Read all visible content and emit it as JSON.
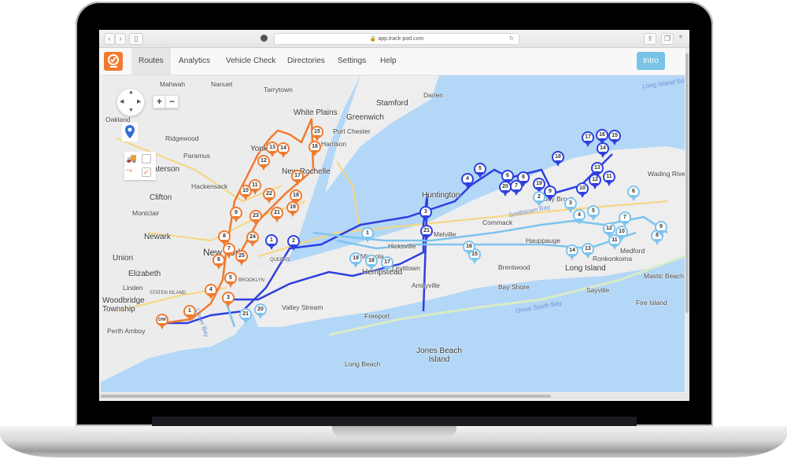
{
  "browser": {
    "url": "app.track-pod.com",
    "back_icon": "chevron-left-icon",
    "forward_icon": "chevron-right-icon",
    "sidebar_icon": "sidebar-icon",
    "privacy_icon": "privacy-icon",
    "reload_icon": "reload-icon",
    "share_icon": "share-icon",
    "tabs_icon": "tabs-icon",
    "new_tab_label": "+"
  },
  "app": {
    "brand_color": "#f07a2e",
    "nav": [
      {
        "label": "Routes",
        "active": true
      },
      {
        "label": "Analytics"
      },
      {
        "label": "Vehicle Check"
      },
      {
        "label": "Directories"
      },
      {
        "label": "Settings"
      },
      {
        "label": "Help"
      }
    ],
    "intro_button": "Intro",
    "intro_color": "#79c3e6"
  },
  "map": {
    "controls": {
      "zoom_in": "+",
      "zoom_out": "−"
    },
    "layer_toggles": [
      {
        "icon": "truck-icon",
        "checked": false
      },
      {
        "icon": "route-icon",
        "checked": true
      }
    ],
    "labels": [
      {
        "text": "Mahwah"
      },
      {
        "text": "Nanuet"
      },
      {
        "text": "Tarrytown"
      },
      {
        "text": "Oakland"
      },
      {
        "text": "Ridgewood"
      },
      {
        "text": "Paramus"
      },
      {
        "text": "Paterson"
      },
      {
        "text": "Hackensack"
      },
      {
        "text": "Clifton"
      },
      {
        "text": "Montclair"
      },
      {
        "text": "Newark"
      },
      {
        "text": "Union"
      },
      {
        "text": "Elizabeth"
      },
      {
        "text": "Linden"
      },
      {
        "text": "Woodbridge Township"
      },
      {
        "text": "Perth Amboy"
      },
      {
        "text": "Staten Island"
      },
      {
        "text": "Lower Bay"
      },
      {
        "text": "New York"
      },
      {
        "text": "Brooklyn"
      },
      {
        "text": "Queens"
      },
      {
        "text": "Yonkers"
      },
      {
        "text": "New Rochelle"
      },
      {
        "text": "White Plains"
      },
      {
        "text": "Harrison"
      },
      {
        "text": "Port Chester"
      },
      {
        "text": "Greenwich"
      },
      {
        "text": "Stamford"
      },
      {
        "text": "Darien"
      },
      {
        "text": "Long Island Sound"
      },
      {
        "text": "Huntington"
      },
      {
        "text": "Hicksville"
      },
      {
        "text": "Melville"
      },
      {
        "text": "Levittown"
      },
      {
        "text": "Hempstead"
      },
      {
        "text": "Mineola"
      },
      {
        "text": "Valley Stream"
      },
      {
        "text": "Freeport"
      },
      {
        "text": "Amityville"
      },
      {
        "text": "Long Beach"
      },
      {
        "text": "Jones Beach Island"
      },
      {
        "text": "Commack"
      },
      {
        "text": "Hauppauge"
      },
      {
        "text": "Brentwood"
      },
      {
        "text": "Bay Shore"
      },
      {
        "text": "Smithtown Bay"
      },
      {
        "text": "Stony Brook"
      },
      {
        "text": "Ronkonkoma"
      },
      {
        "text": "Long Island"
      },
      {
        "text": "Medford"
      },
      {
        "text": "Sayville"
      },
      {
        "text": "Great South Bay"
      },
      {
        "text": "Fire Island"
      },
      {
        "text": "Wading River"
      },
      {
        "text": "Mastic Beach"
      }
    ],
    "routes": [
      {
        "name": "orange",
        "color": "#f07a2e",
        "stops": [
          "D/W",
          "1",
          "3",
          "4",
          "5",
          "6",
          "7",
          "8",
          "9",
          "10",
          "11",
          "12",
          "13",
          "14",
          "15",
          "16",
          "17",
          "18",
          "19",
          "21",
          "22",
          "23",
          "24",
          "25"
        ]
      },
      {
        "name": "dark-blue",
        "color": "#2d3fe0",
        "stops": [
          "1",
          "2",
          "3",
          "4",
          "5",
          "6",
          "7",
          "8",
          "9",
          "10",
          "11",
          "12",
          "13",
          "14",
          "15",
          "16",
          "17",
          "18",
          "19",
          "20",
          "21"
        ]
      },
      {
        "name": "light-blue",
        "color": "#7cc4ee",
        "stops": [
          "1",
          "2",
          "3",
          "4",
          "5",
          "6",
          "7",
          "8",
          "9",
          "10",
          "11",
          "12",
          "13",
          "14",
          "15",
          "16",
          "17",
          "18",
          "19",
          "20",
          "21"
        ]
      }
    ]
  }
}
